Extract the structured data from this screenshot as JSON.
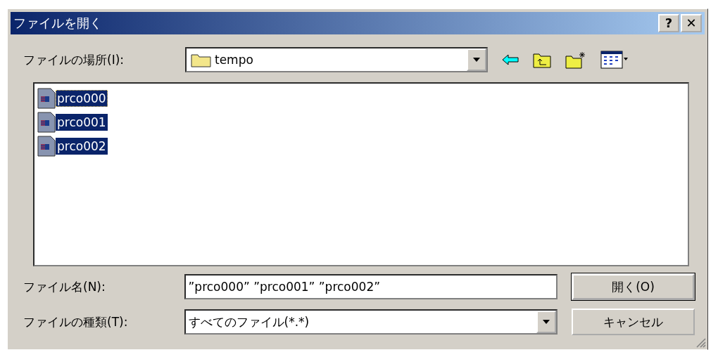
{
  "window": {
    "title": "ファイルを開く",
    "buttons": [
      "?",
      "✕"
    ]
  },
  "location": {
    "label": "ファイルの場所(I):",
    "value": "tempo"
  },
  "files": [
    {
      "name": "prco000",
      "selected": true,
      "focused": true
    },
    {
      "name": "prco001",
      "selected": true,
      "focused": false
    },
    {
      "name": "prco002",
      "selected": true,
      "focused": false
    }
  ],
  "filename": {
    "label": "ファイル名(N):",
    "value": "”prco000” ”prco001” ”prco002”"
  },
  "filetype": {
    "label": "ファイルの種類(T):",
    "value": "すべてのファイル(*.*)"
  },
  "buttons": [
    {
      "label": "開く(O)",
      "default": true
    },
    {
      "label": "キャンセル",
      "default": false
    }
  ]
}
